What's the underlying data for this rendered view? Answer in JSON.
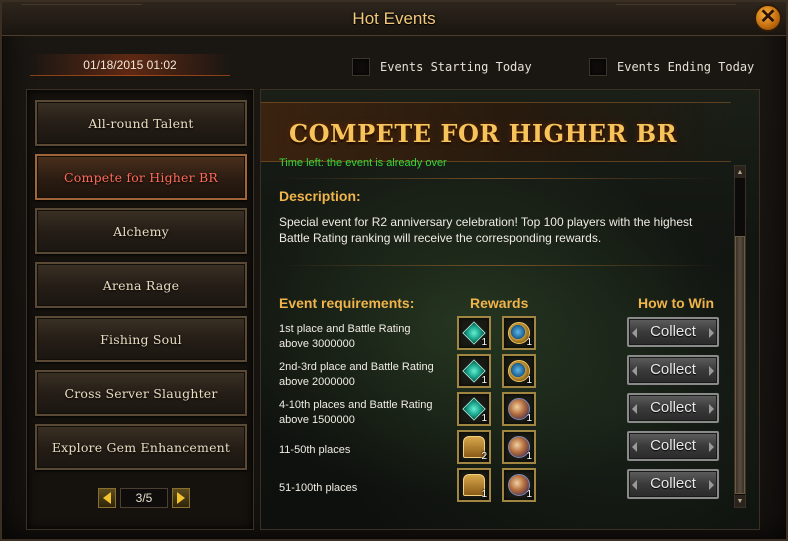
{
  "window": {
    "title": "Hot Events",
    "close_symbol": "✕"
  },
  "date": "01/18/2015 01:02",
  "filters": [
    {
      "label": "Events Starting Today",
      "checked": false
    },
    {
      "label": "Events Ending Today",
      "checked": false
    }
  ],
  "sidebar": {
    "items": [
      {
        "label": "All-round Talent"
      },
      {
        "label": "Compete for Higher BR",
        "active": true
      },
      {
        "label": "Alchemy"
      },
      {
        "label": "Arena Rage"
      },
      {
        "label": "Fishing Soul"
      },
      {
        "label": "Cross Server Slaughter"
      },
      {
        "label": "Explore Gem Enhancement"
      }
    ],
    "pager": {
      "text": "3/5"
    }
  },
  "event": {
    "title": "Compete for Higher BR",
    "time_left": "Time left: the event is already over",
    "description_heading": "Description:",
    "description": "Special event for R2 anniversary celebration! Top 100 players with the highest Battle Rating ranking will receive the corresponding rewards.",
    "headers": {
      "requirements": "Event requirements:",
      "rewards": "Rewards",
      "how_to_win": "How to Win"
    },
    "rows": [
      {
        "requirement": "1st place and Battle Rating above 3000000",
        "rewards": [
          {
            "icon": "gem-icon",
            "qty": "1"
          },
          {
            "icon": "compass-icon",
            "qty": "1"
          }
        ],
        "button": "Collect"
      },
      {
        "requirement": "2nd-3rd place and Battle Rating above 2000000",
        "rewards": [
          {
            "icon": "gem-icon",
            "qty": "1"
          },
          {
            "icon": "compass-icon",
            "qty": "1"
          }
        ],
        "button": "Collect"
      },
      {
        "requirement": "4-10th places and Battle Rating above 1500000",
        "rewards": [
          {
            "icon": "gem-icon",
            "qty": "1"
          },
          {
            "icon": "orb-icon",
            "qty": "1"
          }
        ],
        "button": "Collect"
      },
      {
        "requirement": "11-50th places",
        "rewards": [
          {
            "icon": "chest-icon",
            "qty": "2"
          },
          {
            "icon": "orb-icon",
            "qty": "1"
          }
        ],
        "button": "Collect"
      },
      {
        "requirement": "51-100th places",
        "rewards": [
          {
            "icon": "chest-icon",
            "qty": "1"
          },
          {
            "icon": "orb-icon",
            "qty": "1"
          }
        ],
        "button": "Collect"
      }
    ]
  }
}
